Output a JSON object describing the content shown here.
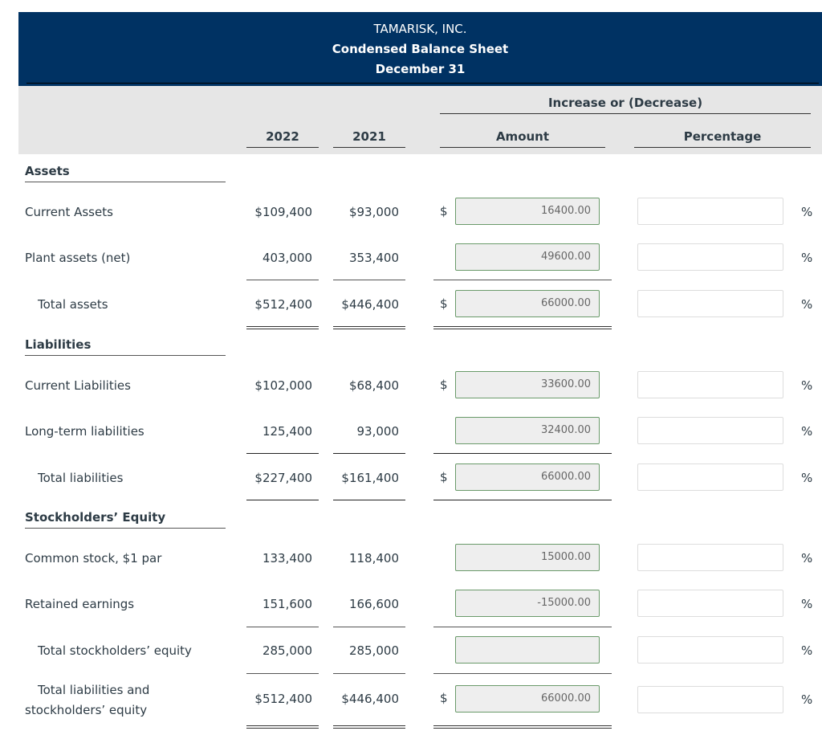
{
  "header": {
    "company": "TAMARISK, INC.",
    "statement": "Condensed Balance Sheet",
    "date": "December 31"
  },
  "columns": {
    "group_label": "Increase or (Decrease)",
    "year1": "2022",
    "year2": "2021",
    "amount": "Amount",
    "percentage": "Percentage"
  },
  "sections": {
    "assets": "Assets",
    "liabilities": "Liabilities",
    "equity": "Stockholders’ Equity"
  },
  "rows": [
    {
      "label": "Current Assets",
      "y2022": "$109,400",
      "y2021": "$93,000",
      "dollar": "$",
      "amount": "16400.00",
      "percentage": "",
      "pct_symbol": "%"
    },
    {
      "label": "Plant assets (net)",
      "y2022": "403,000",
      "y2021": "353,400",
      "dollar": "",
      "amount": "49600.00",
      "percentage": "",
      "pct_symbol": "%"
    },
    {
      "label": "Total assets",
      "y2022": "$512,400",
      "y2021": "$446,400",
      "dollar": "$",
      "amount": "66000.00",
      "percentage": "",
      "pct_symbol": "%"
    },
    {
      "label": "Current Liabilities",
      "y2022": "$102,000",
      "y2021": "$68,400",
      "dollar": "$",
      "amount": "33600.00",
      "percentage": "",
      "pct_symbol": "%"
    },
    {
      "label": "Long-term liabilities",
      "y2022": "125,400",
      "y2021": "93,000",
      "dollar": "",
      "amount": "32400.00",
      "percentage": "",
      "pct_symbol": "%"
    },
    {
      "label": "Total liabilities",
      "y2022": "$227,400",
      "y2021": "$161,400",
      "dollar": "$",
      "amount": "66000.00",
      "percentage": "",
      "pct_symbol": "%"
    },
    {
      "label": "Common stock, $1 par",
      "y2022": "133,400",
      "y2021": "118,400",
      "dollar": "",
      "amount": "15000.00",
      "percentage": "",
      "pct_symbol": "%"
    },
    {
      "label": "Retained earnings",
      "y2022": "151,600",
      "y2021": "166,600",
      "dollar": "",
      "amount": "-15000.00",
      "percentage": "",
      "pct_symbol": "%"
    },
    {
      "label": "Total stockholders’ equity",
      "y2022": "285,000",
      "y2021": "285,000",
      "dollar": "",
      "amount": "",
      "percentage": "",
      "pct_symbol": "%"
    },
    {
      "label_line1": "Total liabilities and",
      "label_line2": "stockholders’ equity",
      "y2022": "$512,400",
      "y2021": "$446,400",
      "dollar": "$",
      "amount": "66000.00",
      "percentage": "",
      "pct_symbol": "%"
    }
  ]
}
